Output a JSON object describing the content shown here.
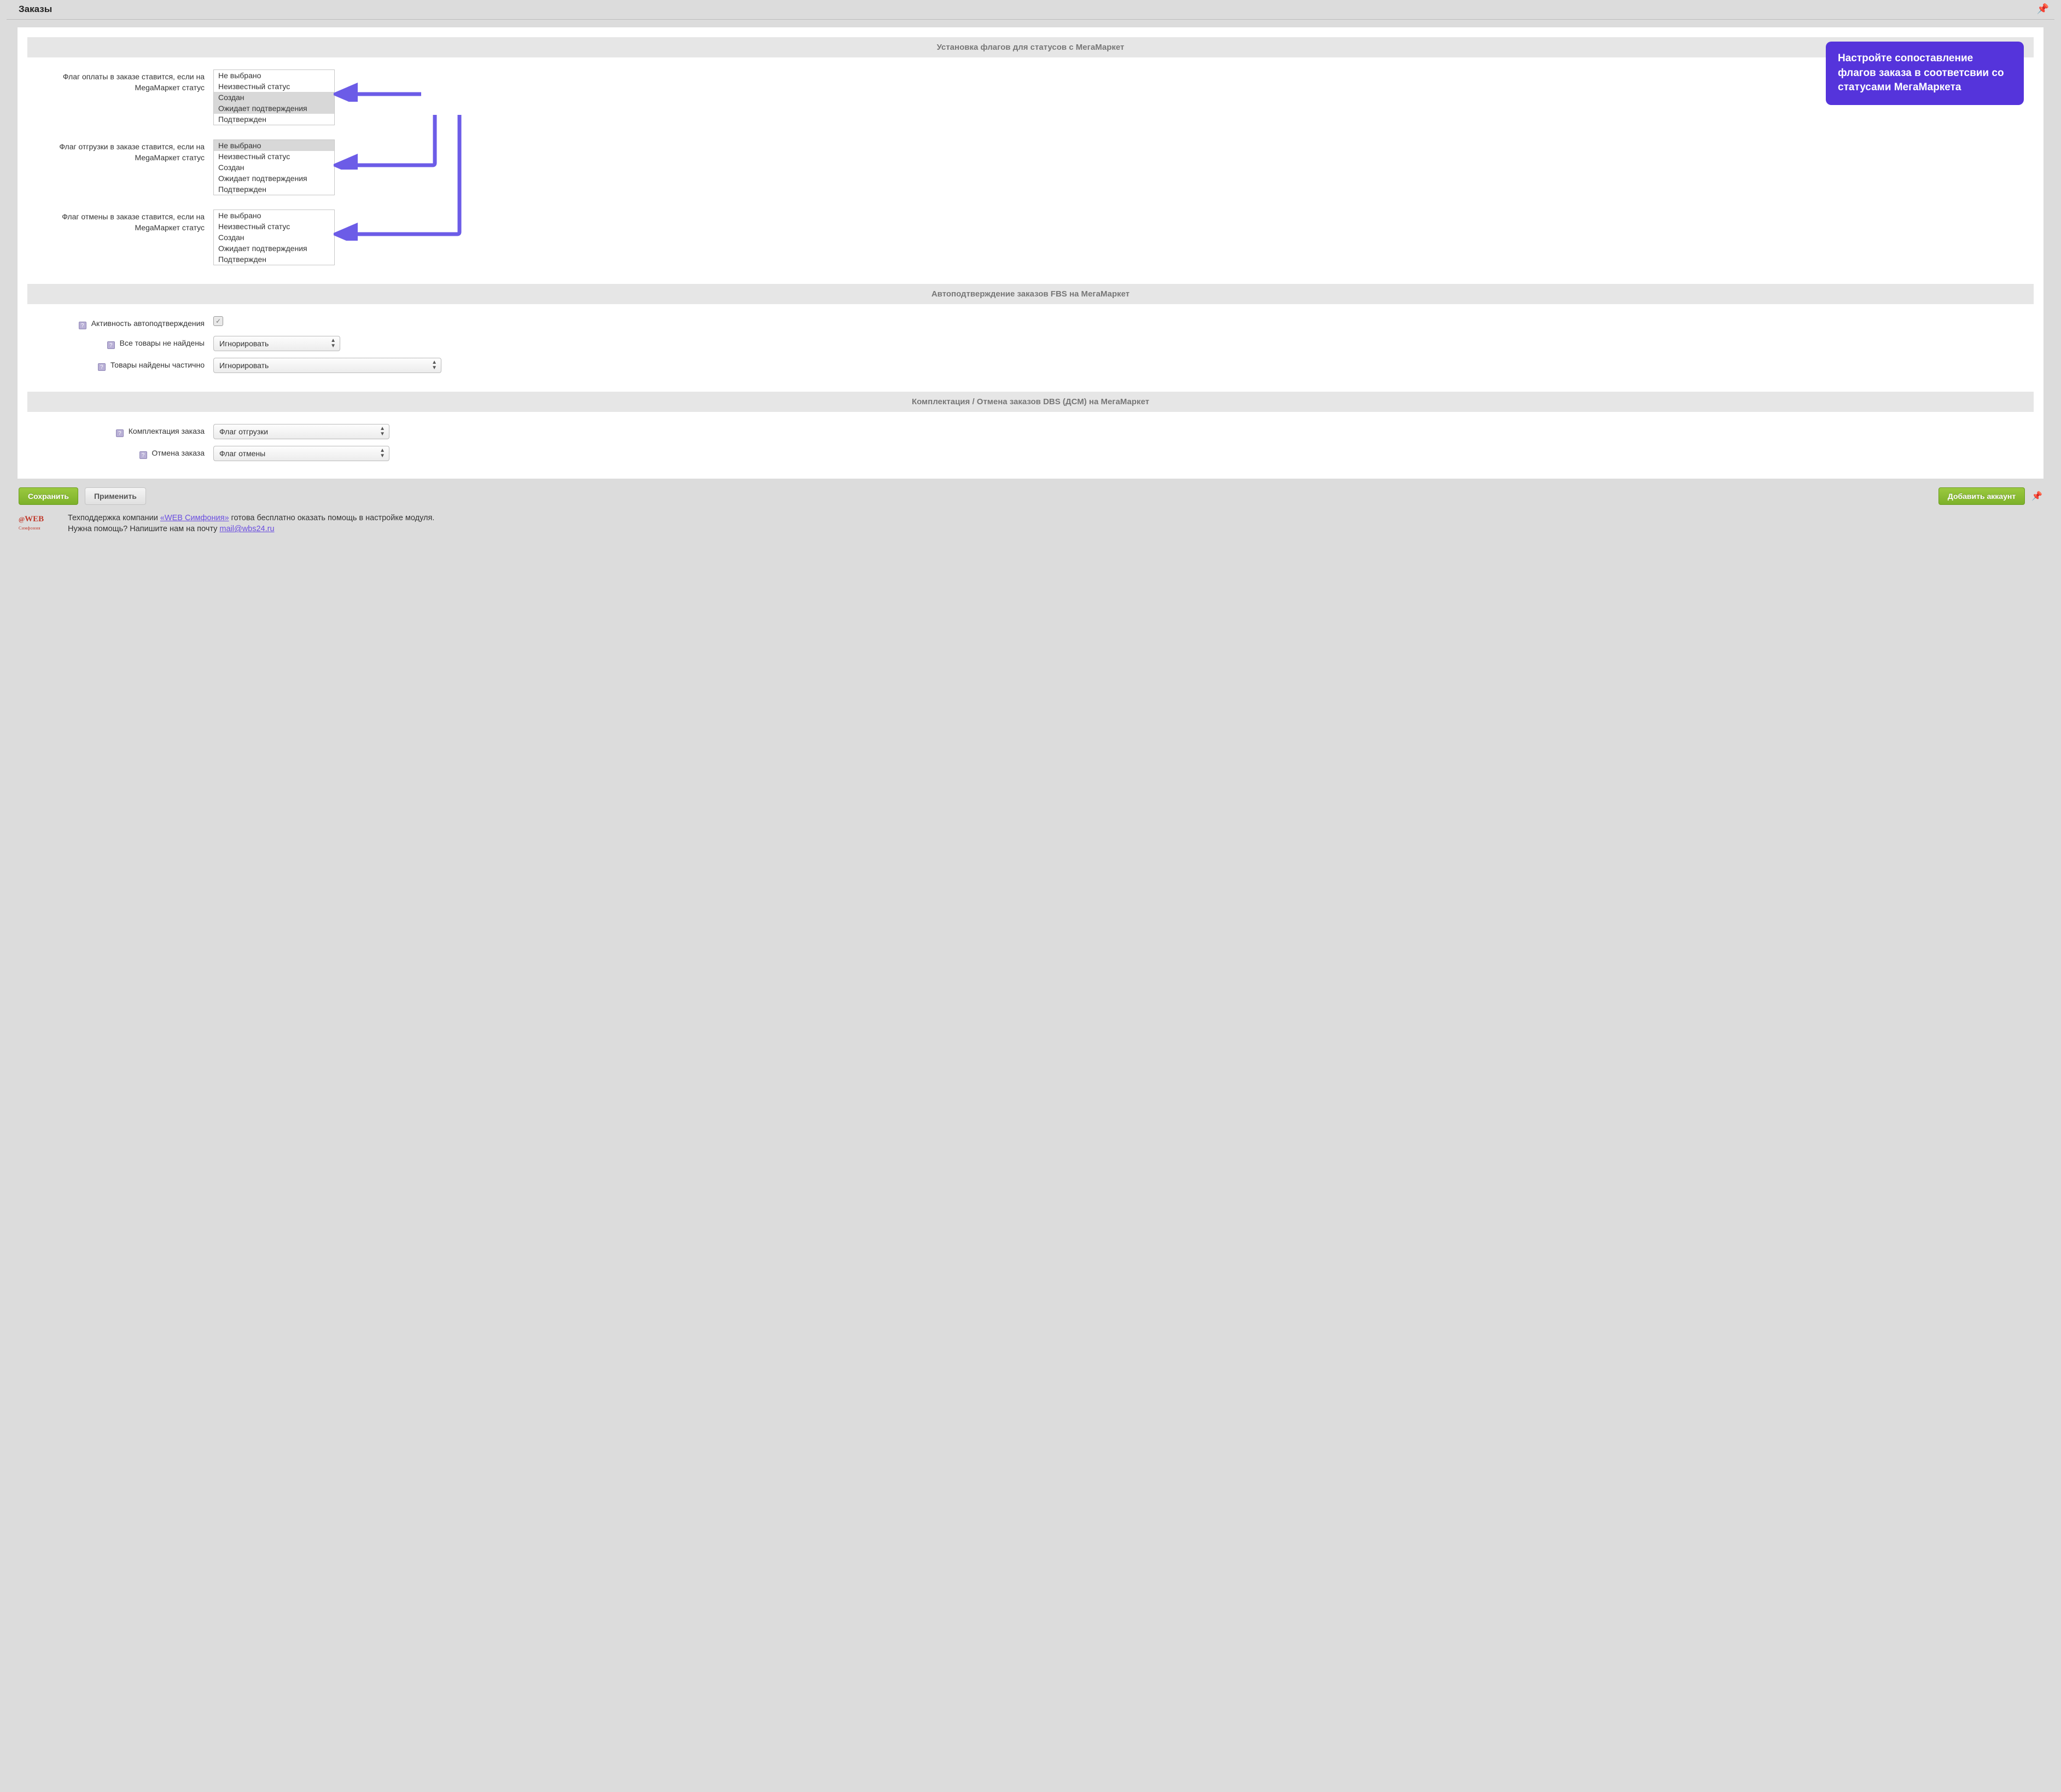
{
  "header": {
    "title": "Заказы"
  },
  "section1": {
    "title": "Установка флагов для статусов с МегаМаркет",
    "rows": [
      {
        "label": "Флаг оплаты в заказе ставится, если на MegaМаркет статус",
        "options": [
          "Не выбрано",
          "Неизвестный статус",
          "Создан",
          "Ожидает подтверждения",
          "Подтвержден"
        ],
        "selected": [
          2,
          3
        ]
      },
      {
        "label": "Флаг отгрузки в заказе ставится, если на MegaМаркет статус",
        "options": [
          "Не выбрано",
          "Неизвестный статус",
          "Создан",
          "Ожидает подтверждения",
          "Подтвержден"
        ],
        "selected": [
          0
        ]
      },
      {
        "label": "Флаг отмены в заказе ставится, если на MegaМаркет статус",
        "options": [
          "Не выбрано",
          "Неизвестный статус",
          "Создан",
          "Ожидает подтверждения",
          "Подтвержден"
        ],
        "selected": []
      }
    ]
  },
  "section2": {
    "title": "Автоподтверждение заказов FBS на МегаМаркет",
    "rows": {
      "activity_label": "Активность автоподтверждения",
      "activity_checked": "✓",
      "not_found_label": "Все товары не найдены",
      "not_found_value": "Игнорировать",
      "partial_label": "Товары найдены частично",
      "partial_value": "Игнорировать"
    }
  },
  "section3": {
    "title": "Комплектация / Отмена заказов DBS (ДСМ) на МегаМаркет",
    "rows": {
      "pack_label": "Комплектация заказа",
      "pack_value": "Флаг отгрузки",
      "cancel_label": "Отмена заказа",
      "cancel_value": "Флаг отмены"
    }
  },
  "tooltip": {
    "text": "Настройте сопоставление флагов заказа в соответсвии со статусами МегаМаркета"
  },
  "footer": {
    "save": "Сохранить",
    "apply": "Применить",
    "add": "Добавить аккаунт",
    "support_line1_prefix": "Техподдержка компании ",
    "support_link1": "«WEB Симфония»",
    "support_line1_suffix": " готова бесплатно оказать помощь в настройке модуля.",
    "support_line2_prefix": "Нужна помощь? Напишите нам на почту ",
    "support_link2": "mail@wbs24.ru"
  }
}
